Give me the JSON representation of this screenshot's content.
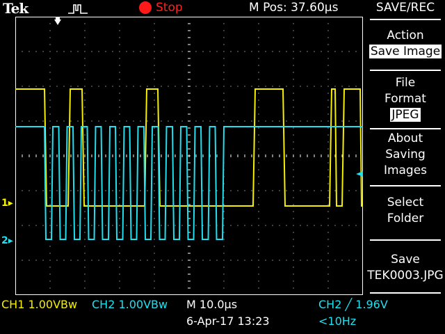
{
  "header": {
    "brand": "Tek",
    "run_state": "Stop",
    "position": "M Pos: 37.60µs"
  },
  "menu": {
    "title": "SAVE/REC",
    "action": {
      "label": "Action",
      "value": "Save Image"
    },
    "file_format": {
      "label1": "File",
      "label2": "Format",
      "value": "JPEG"
    },
    "about": {
      "line1": "About",
      "line2": "Saving",
      "line3": "Images"
    },
    "select_folder": {
      "line1": "Select",
      "line2": "Folder"
    },
    "save": {
      "line1": "Save",
      "line2": "TEK0003.JPG"
    }
  },
  "markers": {
    "ch1": "1",
    "ch2": "2"
  },
  "footer": {
    "ch1": "CH1  1.00VBw",
    "ch2": "CH2  1.00VBw",
    "timebase": "M 10.0µs",
    "datetime": "6-Apr-17 13:23",
    "trigger": "CH2 ╱ 1.96V",
    "freq": "<10Hz"
  },
  "colors": {
    "ch1": "#f5f000",
    "ch2": "#20e0f0",
    "stop": "#ff1a1a",
    "grid": "#ffffff"
  },
  "icons": {
    "trigger": "pulse-icon",
    "run": "stop-dot-icon",
    "trigger_pos": "trigger-arrow-icon"
  }
}
